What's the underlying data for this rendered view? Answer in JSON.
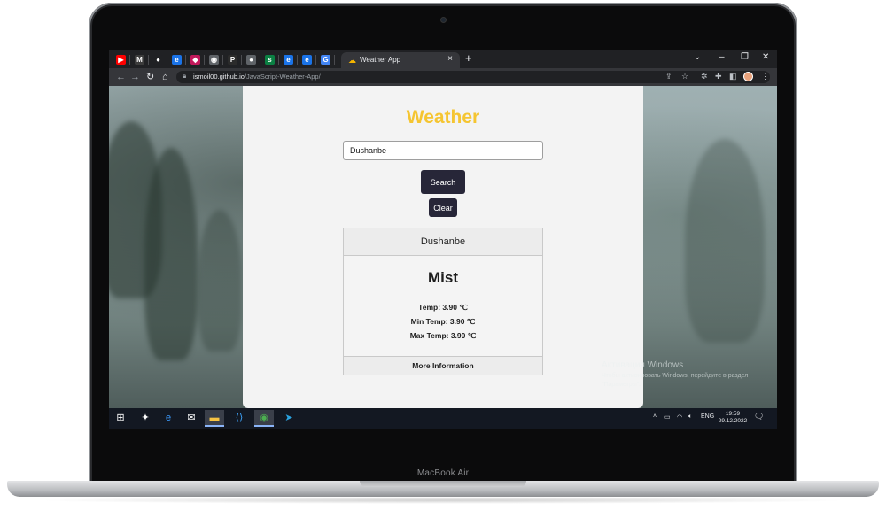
{
  "device": {
    "brand": "MacBook Air"
  },
  "browser": {
    "active_tab_title": "Weather App",
    "new_tab": "+",
    "tab_close": "×",
    "window_controls": {
      "chevron": "⌄",
      "minimize": "–",
      "restore": "❐",
      "close": "✕"
    },
    "url": {
      "host": "ismoil00.github.io",
      "path": "/JavaScript-Weather-App/"
    },
    "mini_tabs": [
      {
        "glyph": "▶",
        "color": "#ff0000"
      },
      {
        "glyph": "M",
        "color": "#3c3c3c"
      },
      {
        "glyph": "●",
        "color": "#202124"
      },
      {
        "glyph": "e",
        "color": "#1a73e8"
      },
      {
        "glyph": "◆",
        "color": "#c2185b"
      },
      {
        "glyph": "◉",
        "color": "#5f6368"
      },
      {
        "glyph": "P",
        "color": "#2b2b2b"
      },
      {
        "glyph": "●",
        "color": "#5f6368"
      },
      {
        "glyph": "s",
        "color": "#0b8043"
      },
      {
        "glyph": "e",
        "color": "#1a73e8"
      },
      {
        "glyph": "e",
        "color": "#1a73e8"
      },
      {
        "glyph": "G",
        "color": "#4285f4"
      }
    ]
  },
  "app": {
    "title": "Weather",
    "title_color": "#f5c531",
    "search_value": "Dushanbe",
    "search_button": "Search",
    "clear_button": "Clear",
    "result": {
      "city": "Dushanbe",
      "description": "Mist",
      "temp": "Temp: 3.90 ℃",
      "min_temp": "Min Temp: 3.90 ℃",
      "max_temp": "Max Temp: 3.90 ℃",
      "more_info": "More Information"
    }
  },
  "activation": {
    "title": "Активация Windows",
    "subtitle": "Чтобы активировать Windows, перейдите в раздел \"Параметры\"."
  },
  "taskbar": {
    "language": "ENG",
    "time": "19:59",
    "date": "29.12.2022"
  }
}
